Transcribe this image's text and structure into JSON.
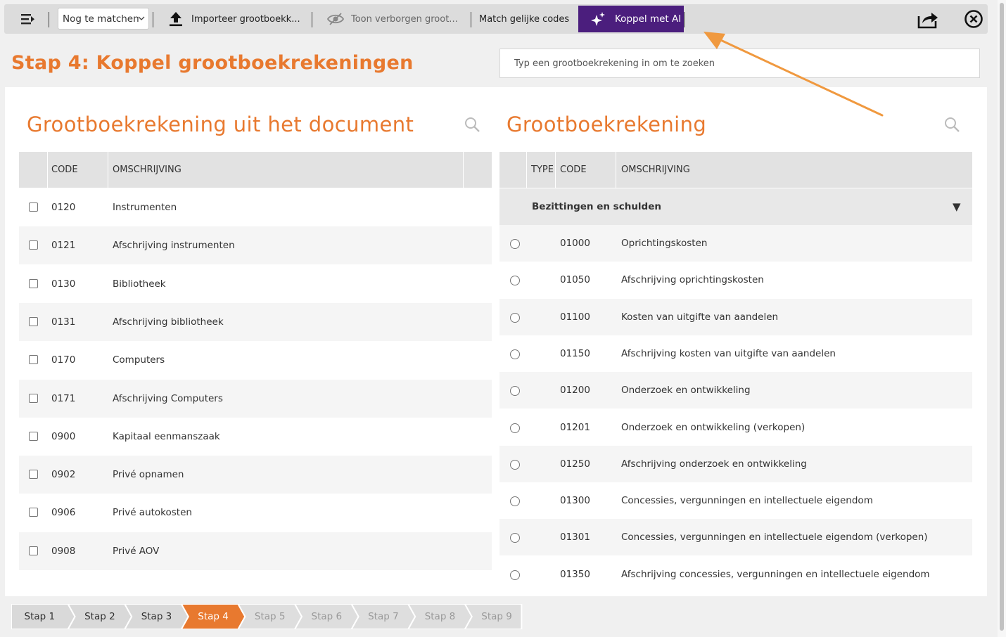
{
  "toolbar": {
    "filter_value": "Nog te matchen",
    "import_label": "Importeer grootboekk...",
    "show_hidden_label": "Toon verborgen groot...",
    "match_codes_label": "Match gelijke codes",
    "ai_label": "Koppel met AI"
  },
  "header": {
    "title": "Stap 4: Koppel grootboekrekeningen",
    "search_placeholder": "Typ een grootboekrekening in om te zoeken"
  },
  "left": {
    "title": "Grootboekrekening uit het document",
    "columns": {
      "code": "CODE",
      "description": "OMSCHRIJVING"
    },
    "rows": [
      {
        "code": "0120",
        "description": "Instrumenten"
      },
      {
        "code": "0121",
        "description": "Afschrijving instrumenten"
      },
      {
        "code": "0130",
        "description": "Bibliotheek"
      },
      {
        "code": "0131",
        "description": "Afschrijving bibliotheek"
      },
      {
        "code": "0170",
        "description": "Computers"
      },
      {
        "code": "0171",
        "description": "Afschrijving Computers"
      },
      {
        "code": "0900",
        "description": "Kapitaal eenmanszaak"
      },
      {
        "code": "0902",
        "description": "Privé opnamen"
      },
      {
        "code": "0906",
        "description": "Privé autokosten"
      },
      {
        "code": "0908",
        "description": "Privé AOV"
      }
    ]
  },
  "right": {
    "title": "Grootboekrekening",
    "columns": {
      "type": "TYPE",
      "code": "CODE",
      "description": "OMSCHRIJVING"
    },
    "group": {
      "label": "Bezittingen en schulden",
      "toggle": "▼"
    },
    "rows": [
      {
        "code": "01000",
        "description": "Oprichtingskosten"
      },
      {
        "code": "01050",
        "description": "Afschrijving oprichtingskosten"
      },
      {
        "code": "01100",
        "description": "Kosten van uitgifte van aandelen"
      },
      {
        "code": "01150",
        "description": "Afschrijving kosten van uitgifte van aandelen"
      },
      {
        "code": "01200",
        "description": "Onderzoek en ontwikkeling"
      },
      {
        "code": "01201",
        "description": "Onderzoek en ontwikkeling (verkopen)"
      },
      {
        "code": "01250",
        "description": "Afschrijving onderzoek en ontwikkeling"
      },
      {
        "code": "01300",
        "description": "Concessies, vergunningen en intellectuele eigendom"
      },
      {
        "code": "01301",
        "description": "Concessies, vergunningen en intellectuele eigendom (verkopen)"
      },
      {
        "code": "01350",
        "description": "Afschrijving concessies, vergunningen en intellectuele eigendom"
      }
    ]
  },
  "steps": [
    {
      "label": "Stap 1",
      "state": "done"
    },
    {
      "label": "Stap 2",
      "state": "done"
    },
    {
      "label": "Stap 3",
      "state": "done"
    },
    {
      "label": "Stap 4",
      "state": "active"
    },
    {
      "label": "Stap 5",
      "state": "todo"
    },
    {
      "label": "Stap 6",
      "state": "todo"
    },
    {
      "label": "Stap 7",
      "state": "todo"
    },
    {
      "label": "Stap 8",
      "state": "todo"
    },
    {
      "label": "Stap 9",
      "state": "todo"
    }
  ],
  "colors": {
    "accent": "#e8792f",
    "ai_button": "#4b1e7d",
    "annotation_arrow": "#f0993f"
  },
  "icons": {
    "menu": "menu-collapse-icon",
    "import": "upload-arrow-icon",
    "hidden": "eye-slash-icon",
    "ai": "sparkles-icon",
    "export": "share-icon",
    "close": "close-circle-icon",
    "search": "magnifier-icon"
  }
}
